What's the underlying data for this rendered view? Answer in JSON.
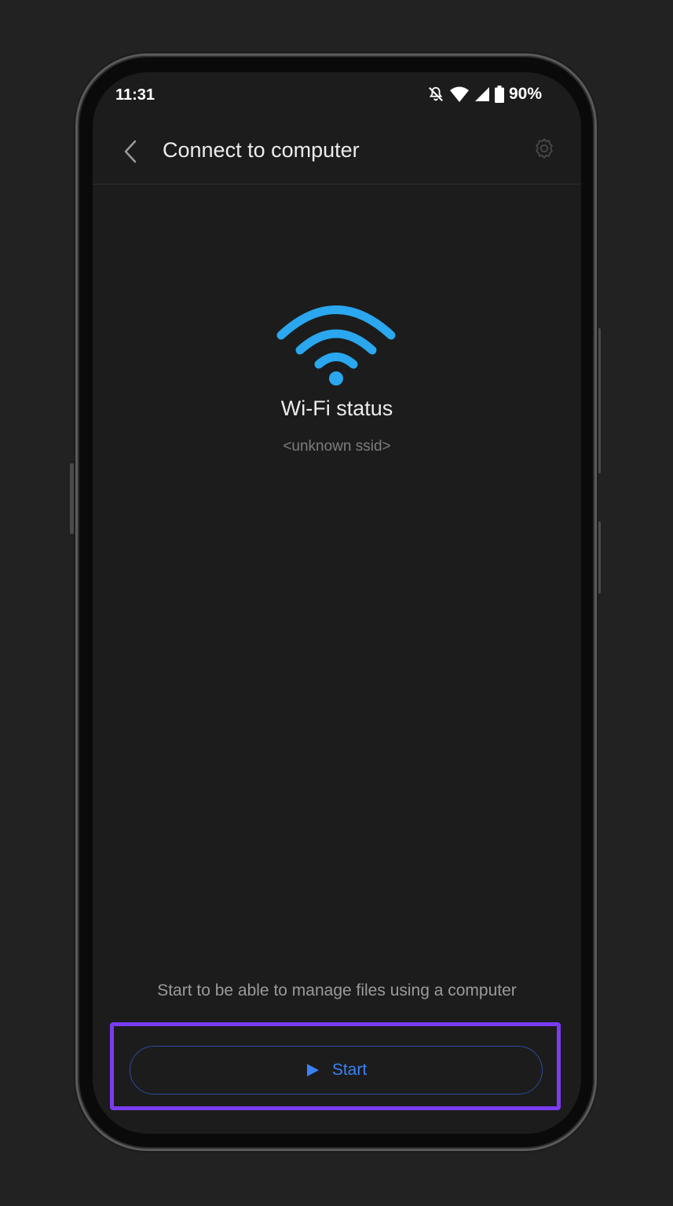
{
  "status_bar": {
    "time": "11:31",
    "battery": "90%",
    "icons": [
      "mute-notifications-icon",
      "wifi-icon",
      "cellular-signal-icon",
      "battery-icon"
    ]
  },
  "header": {
    "title": "Connect to computer",
    "back_icon": "back-chevron-icon",
    "settings_icon": "gear-icon"
  },
  "main": {
    "status_icon": "wifi-icon",
    "status_title": "Wi-Fi status",
    "ssid": "<unknown ssid>",
    "hint": "Start to be able to manage files using a computer",
    "start_label": "Start"
  },
  "colors": {
    "accent": "#3b82f6",
    "wifi": "#2aa7ee",
    "highlight": "#7a3cf0",
    "background": "#1c1c1c"
  }
}
